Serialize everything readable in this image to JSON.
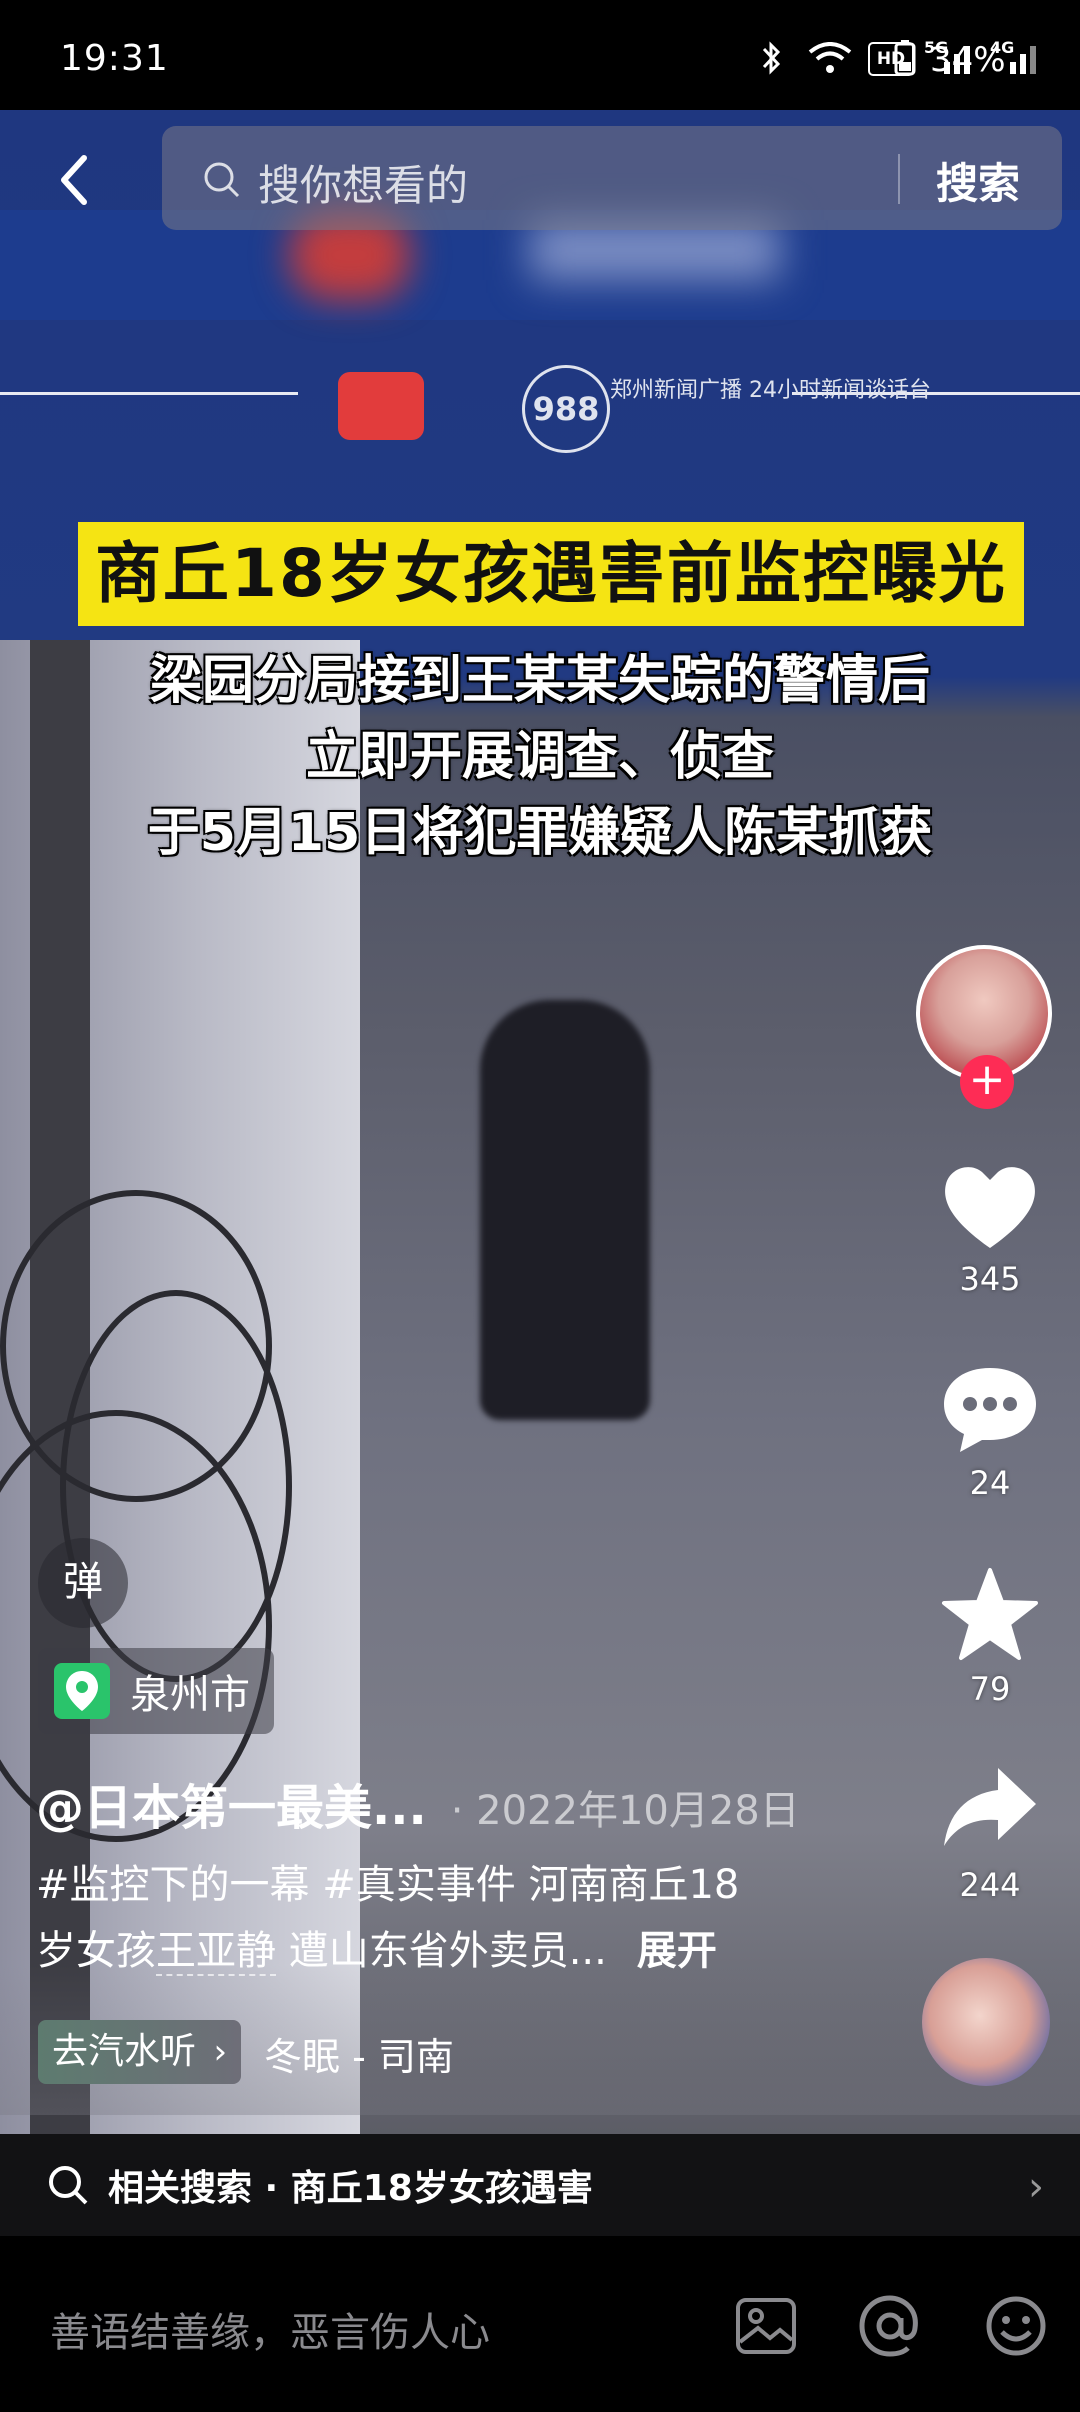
{
  "status_bar": {
    "time": "19:31",
    "battery": "34%",
    "network_labels": [
      "HD",
      "5G",
      "4G"
    ]
  },
  "search": {
    "placeholder": "搜你想看的",
    "button": "搜索"
  },
  "video": {
    "headline": "商丘18岁女孩遇害前监控曝光",
    "captions": [
      "梁园分局接到王某某失踪的警情后",
      "立即开展调查、侦查",
      "于5月15日将犯罪嫌疑人陈某抓获"
    ],
    "station_logo_text": "郑州新闻广播 24小时新闻谈话台",
    "station_logo_number": "988"
  },
  "actions": {
    "likes": "345",
    "comments": "24",
    "favorites": "79",
    "shares": "244"
  },
  "danmu_label": "弹",
  "location": "泉州市",
  "author": "@日本第一最美...",
  "date": "· 2022年10月28日",
  "description": {
    "line1": "#监控下的一幕 #真实事件 河南商丘18",
    "line2_prefix": "岁女孩",
    "line2_highlight": "王亚静",
    "line2_suffix": " 遭山东省外卖员...",
    "expand": "展开"
  },
  "music": {
    "tag": "去汽水听",
    "name": "冬眠 - 司南"
  },
  "related_search": "相关搜索 · 商丘18岁女孩遇害",
  "comment": {
    "placeholder": "善语结善缘，恶言伤人心"
  },
  "icons": [
    "back-icon",
    "search-icon",
    "heart-icon",
    "comment-icon",
    "star-icon",
    "share-icon",
    "image-icon",
    "at-icon",
    "emoji-icon",
    "location-pin-icon",
    "chevron-right-icon",
    "bluetooth-icon",
    "wifi-icon",
    "battery-icon"
  ],
  "colors": {
    "accent_red": "#fe2c55",
    "headline_yellow": "#f5e413",
    "location_green": "#2ac46b"
  }
}
